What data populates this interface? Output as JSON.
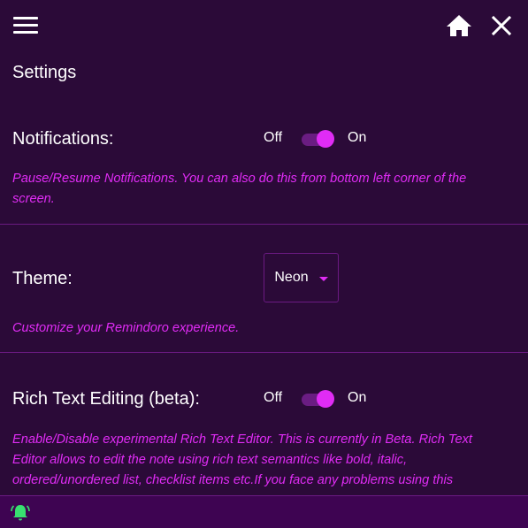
{
  "header": {
    "menu_icon": "hamburger-menu-icon",
    "home_icon": "home-icon",
    "close_icon": "close-icon"
  },
  "page_title": "Settings",
  "notifications": {
    "label": "Notifications:",
    "off_label": "Off",
    "on_label": "On",
    "enabled": true,
    "description": "Pause/Resume Notifications. You can also do this from bottom left corner of the screen."
  },
  "theme": {
    "label": "Theme:",
    "selected": "Neon",
    "description": "Customize your Remindoro experience."
  },
  "rich_text": {
    "label": "Rich Text Editing (beta):",
    "off_label": "Off",
    "on_label": "On",
    "enabled": true,
    "description": "Enable/Disable experimental Rich Text Editor. This is currently in Beta. Rich Text Editor allows to edit the note using rich text semantics like bold, italic, ordered/unordered list, checklist items etc.If you face any problems using this"
  },
  "footer": {
    "bell_icon": "notification-bell-icon"
  },
  "colors": {
    "background": "#2b0a38",
    "accent": "#e02cf5",
    "bell": "#38e070",
    "divider": "#6b1a82"
  }
}
